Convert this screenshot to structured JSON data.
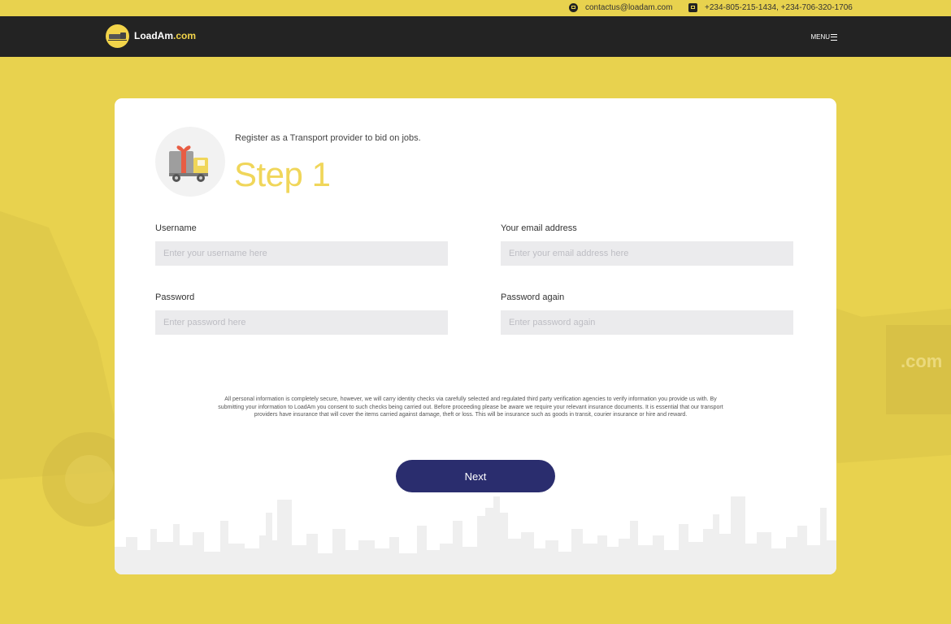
{
  "topbar": {
    "email": "contactus@loadam.com",
    "phones": "+234-805-215-1434, +234-706-320-1706",
    "email_icon": "envelope-icon",
    "phone_icon": "phone-icon"
  },
  "navbar": {
    "brand_name": "LoadAm",
    "brand_suffix": ".com",
    "menu_label": "MENU",
    "menu_icon": "hamburger-icon"
  },
  "form": {
    "subtitle": "Register as a Transport provider to bid on jobs.",
    "step_title": "Step 1",
    "fields": [
      {
        "label": "Username",
        "placeholder": "Enter your username here",
        "value": ""
      },
      {
        "label": "Your email address",
        "placeholder": "Enter your email address here",
        "value": ""
      },
      {
        "label": "Password",
        "placeholder": "Enter password here",
        "value": ""
      },
      {
        "label": "Password again",
        "placeholder": "Enter password again",
        "value": ""
      }
    ],
    "disclaimer": "All personal information is completely secure, however, we will carry identity checks via carefully selected and regulated third party verification agencies to verify information you provide us with. By submitting your information to LoadAm you consent to such checks being carried out. Before proceeding please be aware we require your relevant insurance documents. It is essential that our transport providers have insurance that will cover the items carried against damage, theft or loss. This will be insurance such as goods in transit, courier insurance or hire and reward.",
    "next_label": "Next"
  },
  "colors": {
    "page_background": "#e8d24e",
    "navbar": "#232323",
    "accent_yellow": "#f0d65a",
    "button": "#2a2d6e"
  }
}
